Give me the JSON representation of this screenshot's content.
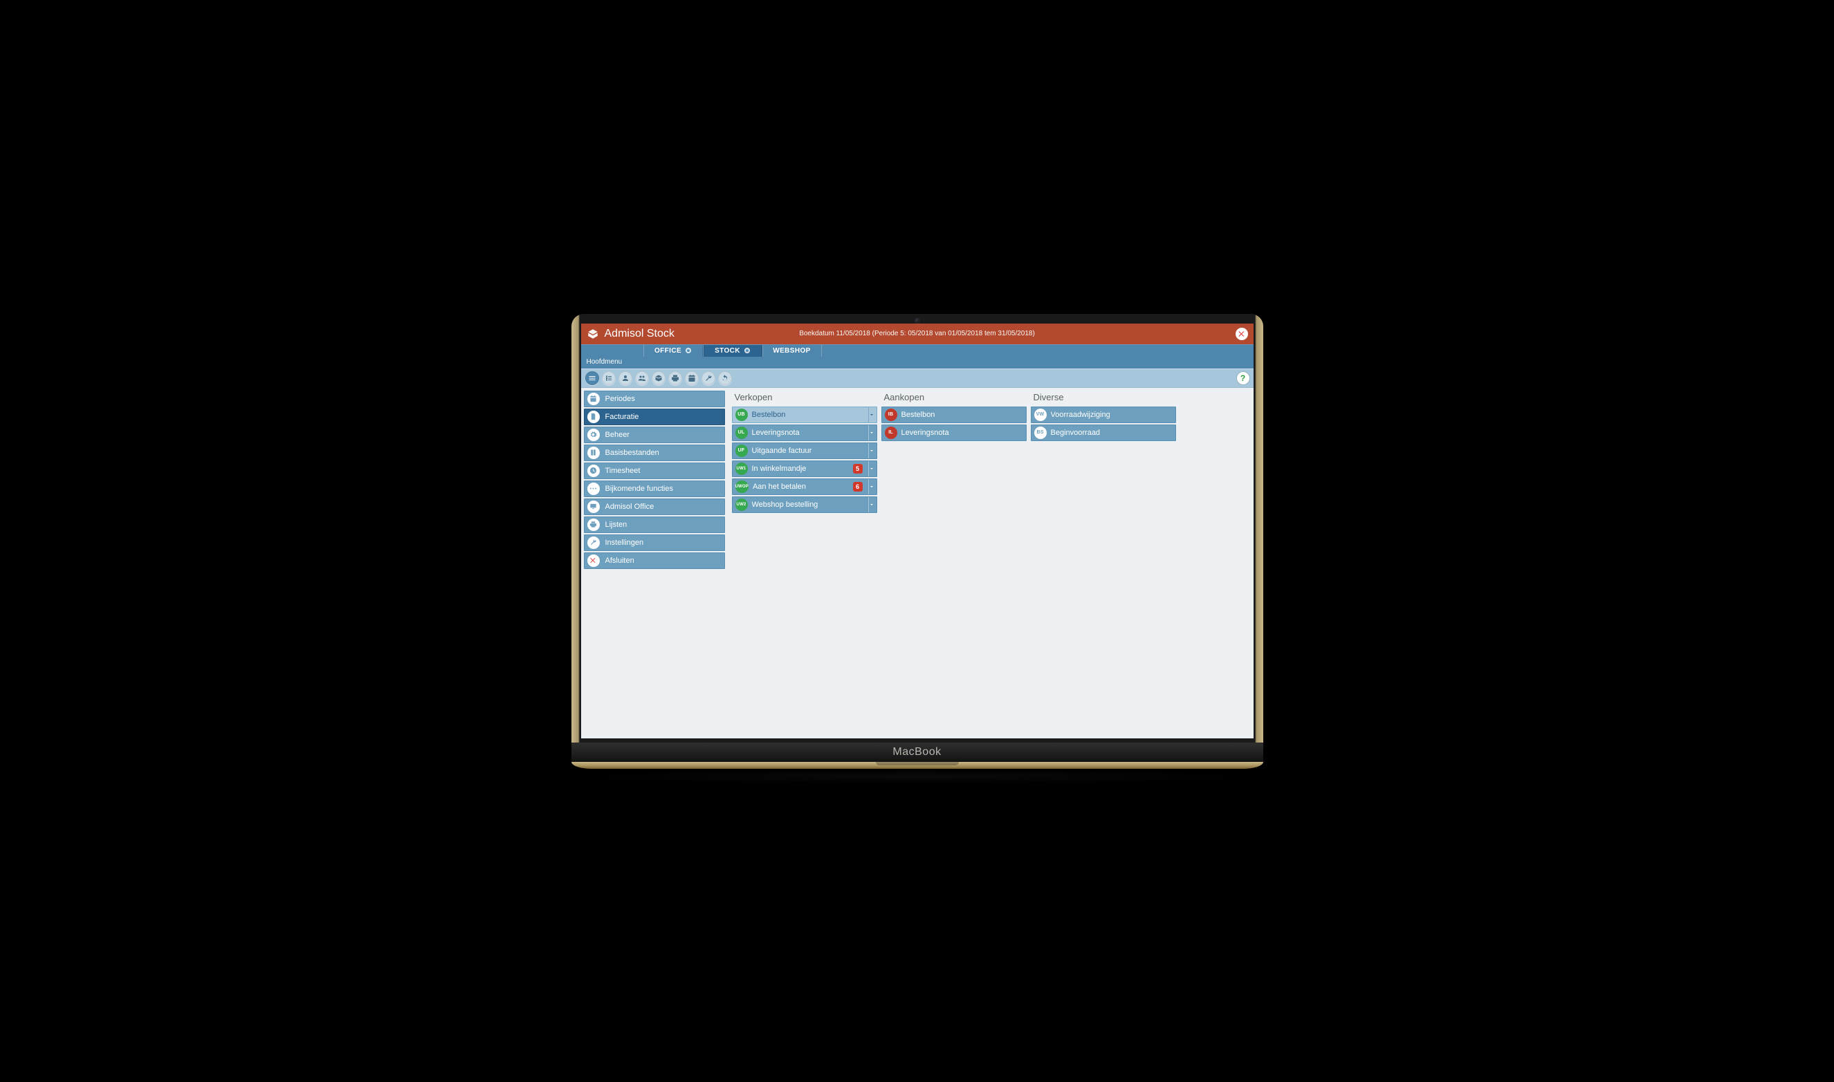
{
  "device_label": "MacBook",
  "app": {
    "title": "Admisol Stock",
    "status": "Boekdatum 11/05/2018 (Periode 5: 05/2018 van 01/05/2018 tem 31/05/2018)"
  },
  "module_tabs": [
    {
      "label": "OFFICE",
      "active": false,
      "has_dot": true
    },
    {
      "label": "STOCK",
      "active": true,
      "has_dot": true
    },
    {
      "label": "WEBSHOP",
      "active": false,
      "has_dot": false
    }
  ],
  "breadcrumb": "Hoofdmenu",
  "toolbar_icons": [
    {
      "name": "menu",
      "primary": true
    },
    {
      "name": "list",
      "primary": false
    },
    {
      "name": "person",
      "primary": false
    },
    {
      "name": "group",
      "primary": false
    },
    {
      "name": "box",
      "primary": false
    },
    {
      "name": "print",
      "primary": false
    },
    {
      "name": "calendar",
      "primary": false
    },
    {
      "name": "wrench",
      "primary": false
    },
    {
      "name": "refresh",
      "primary": false
    }
  ],
  "help_glyph": "?",
  "sidebar": [
    {
      "label": "Periodes",
      "icon": "calendar",
      "selected": false
    },
    {
      "label": "Facturatie",
      "icon": "invoice",
      "selected": true
    },
    {
      "label": "Beheer",
      "icon": "gear",
      "selected": false
    },
    {
      "label": "Basisbestanden",
      "icon": "files",
      "selected": false
    },
    {
      "label": "Timesheet",
      "icon": "clock",
      "selected": false
    },
    {
      "label": "Bijkomende functies",
      "icon": "dots",
      "selected": false
    },
    {
      "label": "Admisol Office",
      "icon": "screen",
      "selected": false
    },
    {
      "label": "Lijsten",
      "icon": "printer",
      "selected": false
    },
    {
      "label": "Instellingen",
      "icon": "wrench",
      "selected": false
    },
    {
      "label": "Afsluiten",
      "icon": "close",
      "selected": false,
      "exit": true
    }
  ],
  "columns": [
    {
      "title": "Verkopen",
      "items": [
        {
          "code": "UB",
          "label": "Bestelbon",
          "chip": "green",
          "selected": true,
          "dropdown": true,
          "badge": null
        },
        {
          "code": "UL",
          "label": "Leveringsnota",
          "chip": "green",
          "selected": false,
          "dropdown": true,
          "badge": null
        },
        {
          "code": "UF",
          "label": "Uitgaande factuur",
          "chip": "green",
          "selected": false,
          "dropdown": true,
          "badge": null
        },
        {
          "code": "UW1",
          "label": "In winkelmandje",
          "chip": "green",
          "selected": false,
          "dropdown": true,
          "badge": "5"
        },
        {
          "code": "UWOP",
          "label": "Aan het betalen",
          "chip": "green",
          "selected": false,
          "dropdown": true,
          "badge": "6"
        },
        {
          "code": "UW2",
          "label": "Webshop bestelling",
          "chip": "green",
          "selected": false,
          "dropdown": true,
          "badge": null
        }
      ]
    },
    {
      "title": "Aankopen",
      "items": [
        {
          "code": "IB",
          "label": "Bestelbon",
          "chip": "red",
          "selected": false,
          "dropdown": false,
          "badge": null
        },
        {
          "code": "IL",
          "label": "Leveringsnota",
          "chip": "red",
          "selected": false,
          "dropdown": false,
          "badge": null
        }
      ]
    },
    {
      "title": "Diverse",
      "items": [
        {
          "code": "VW",
          "label": "Voorraadwijziging",
          "chip": "white",
          "selected": false,
          "dropdown": false,
          "badge": null
        },
        {
          "code": "BS",
          "label": "Beginvoorraad",
          "chip": "white",
          "selected": false,
          "dropdown": false,
          "badge": null
        }
      ]
    }
  ]
}
